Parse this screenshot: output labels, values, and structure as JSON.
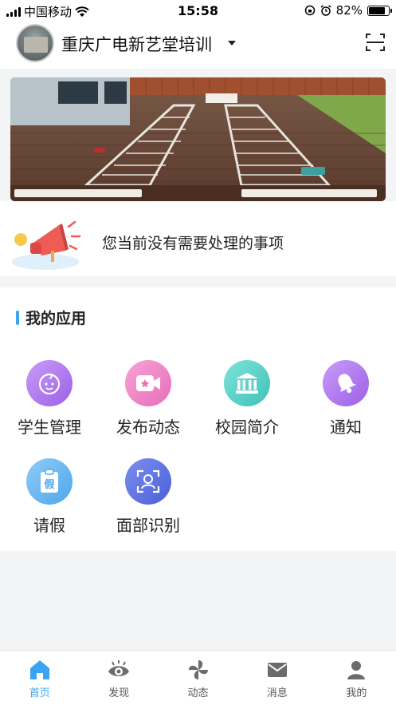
{
  "status_bar": {
    "carrier": "中国移动",
    "time": "15:58",
    "battery": "82%",
    "battery_level": 0.82
  },
  "header": {
    "org_name": "重庆广电新艺堂培训"
  },
  "todo": {
    "message": "您当前没有需要处理的事项"
  },
  "apps": {
    "title": "我的应用",
    "items": [
      {
        "label": "学生管理",
        "icon": "baby-face-icon",
        "color": "#b57ff0"
      },
      {
        "label": "发布动态",
        "icon": "video-camera-icon",
        "color": "#f084c6"
      },
      {
        "label": "校园简介",
        "icon": "school-building-icon",
        "color": "#5fd3c9"
      },
      {
        "label": "通知",
        "icon": "bell-icon",
        "color": "#b57ff0"
      },
      {
        "label": "请假",
        "icon": "leave-clipboard-icon",
        "color": "#6ab6f0"
      },
      {
        "label": "面部识别",
        "icon": "face-scan-icon",
        "color": "#5b6fe0"
      }
    ]
  },
  "tabbar": {
    "items": [
      {
        "label": "首页",
        "icon": "home-icon",
        "active": true
      },
      {
        "label": "发现",
        "icon": "eye-icon",
        "active": false
      },
      {
        "label": "动态",
        "icon": "pinwheel-icon",
        "active": false
      },
      {
        "label": "消息",
        "icon": "mail-icon",
        "active": false
      },
      {
        "label": "我的",
        "icon": "person-icon",
        "active": false
      }
    ]
  },
  "colors": {
    "accent": "#3aa4f2",
    "background": "#f3f4f6"
  }
}
